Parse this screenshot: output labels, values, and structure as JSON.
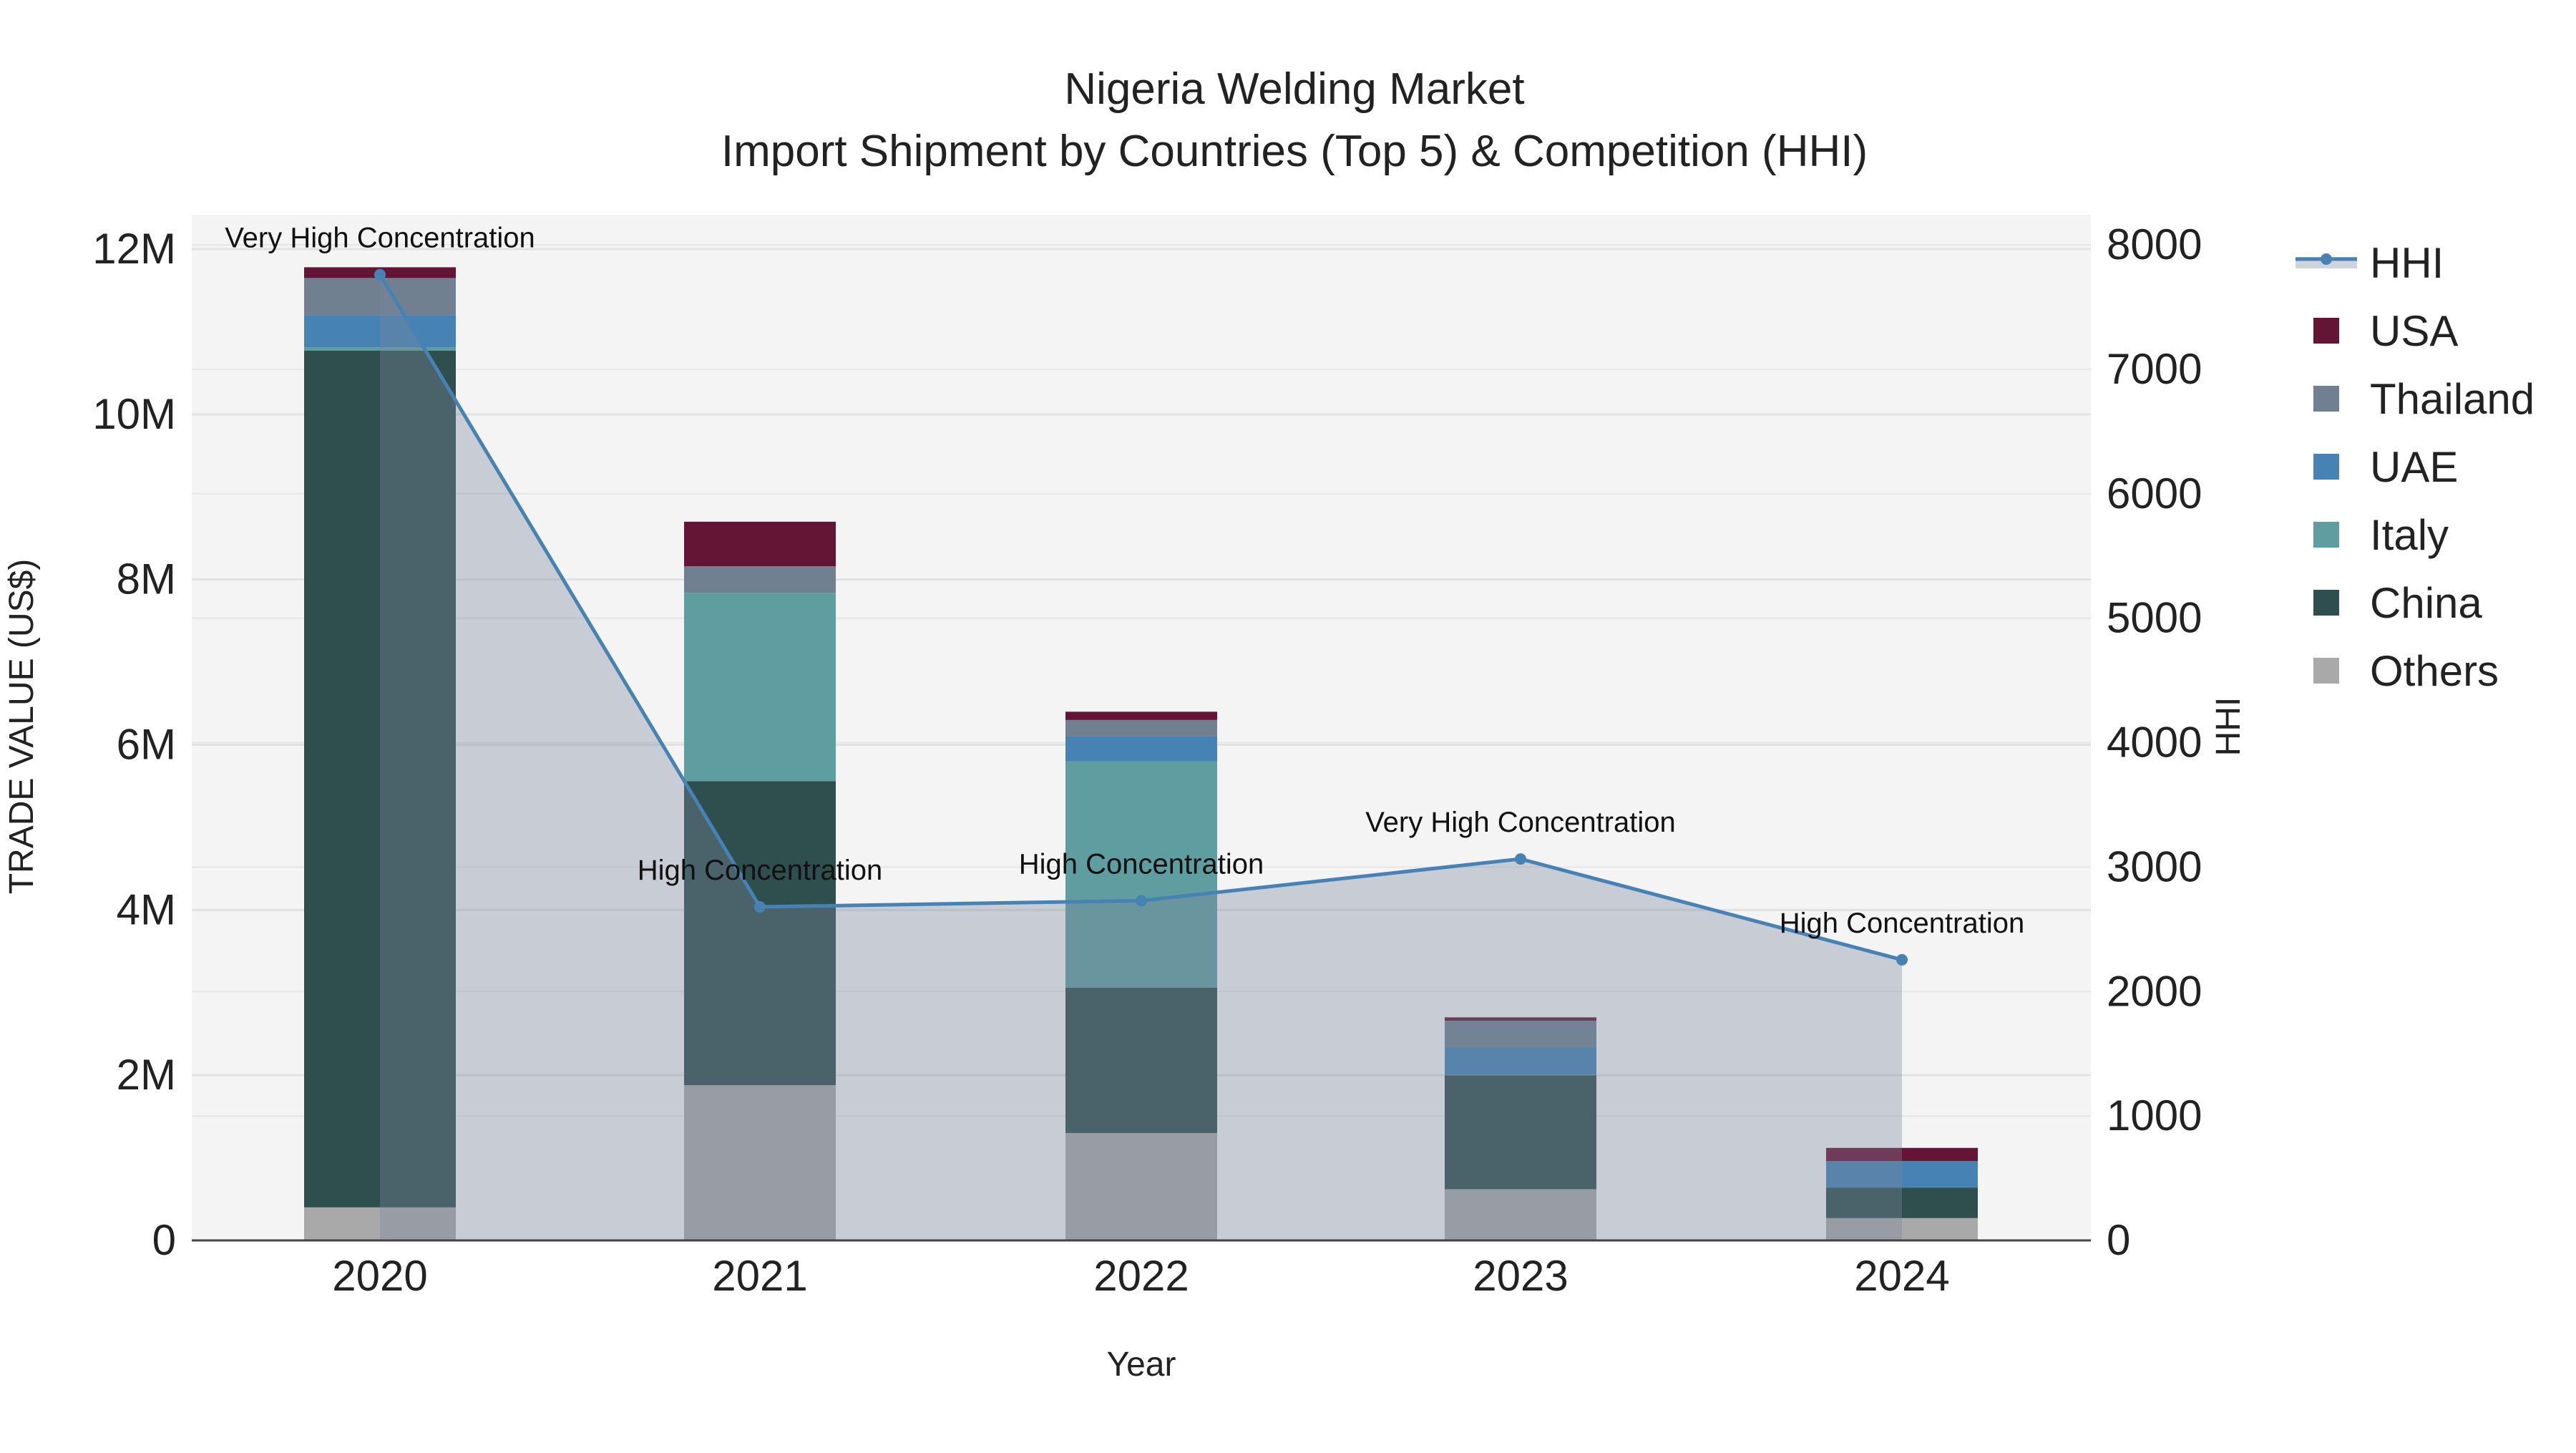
{
  "chart_data": {
    "type": "bar",
    "title": "Nigeria Welding Market",
    "subtitle": "Import Shipment by Countries (Top 5) & Competition (HHI)",
    "xlabel": "Year",
    "ylabel": "TRADE VALUE (US$)",
    "y2label": "HHI",
    "categories": [
      "2020",
      "2021",
      "2022",
      "2023",
      "2024"
    ],
    "ylim": [
      0,
      12000000
    ],
    "y2lim": [
      0,
      8000
    ],
    "yticks": [
      {
        "v": 0,
        "label": "0"
      },
      {
        "v": 2000000,
        "label": "2M"
      },
      {
        "v": 4000000,
        "label": "4M"
      },
      {
        "v": 6000000,
        "label": "6M"
      },
      {
        "v": 8000000,
        "label": "8M"
      },
      {
        "v": 10000000,
        "label": "10M"
      },
      {
        "v": 12000000,
        "label": "12M"
      }
    ],
    "y2ticks": [
      "0",
      "1000",
      "2000",
      "3000",
      "4000",
      "5000",
      "6000",
      "7000",
      "8000"
    ],
    "grid": true,
    "legend_position": "right",
    "series": [
      {
        "name": "Others",
        "color": "#a9a9a9",
        "values": [
          400000,
          1880000,
          1300000,
          620000,
          270000
        ]
      },
      {
        "name": "China",
        "color": "#2f4f4f",
        "values": [
          10370000,
          3680000,
          1760000,
          1380000,
          370000
        ]
      },
      {
        "name": "Italy",
        "color": "#5f9ea0",
        "values": [
          40000,
          2280000,
          2740000,
          10000,
          0
        ]
      },
      {
        "name": "UAE",
        "color": "#4682b4",
        "values": [
          390000,
          0,
          300000,
          330000,
          320000
        ]
      },
      {
        "name": "Thailand",
        "color": "#708090",
        "values": [
          450000,
          320000,
          200000,
          320000,
          0
        ]
      },
      {
        "name": "USA",
        "color": "#641434",
        "values": [
          130000,
          540000,
          100000,
          40000,
          160000
        ]
      }
    ],
    "hhi": {
      "name": "HHI",
      "color": "#4682b4",
      "values": [
        7760,
        2680,
        2730,
        3065,
        2255
      ],
      "annotations": [
        "Very High Concentration",
        "High Concentration",
        "High Concentration",
        "Very High Concentration",
        "High Concentration"
      ]
    },
    "legend_order": [
      "HHI",
      "USA",
      "Thailand",
      "UAE",
      "Italy",
      "China",
      "Others"
    ]
  }
}
